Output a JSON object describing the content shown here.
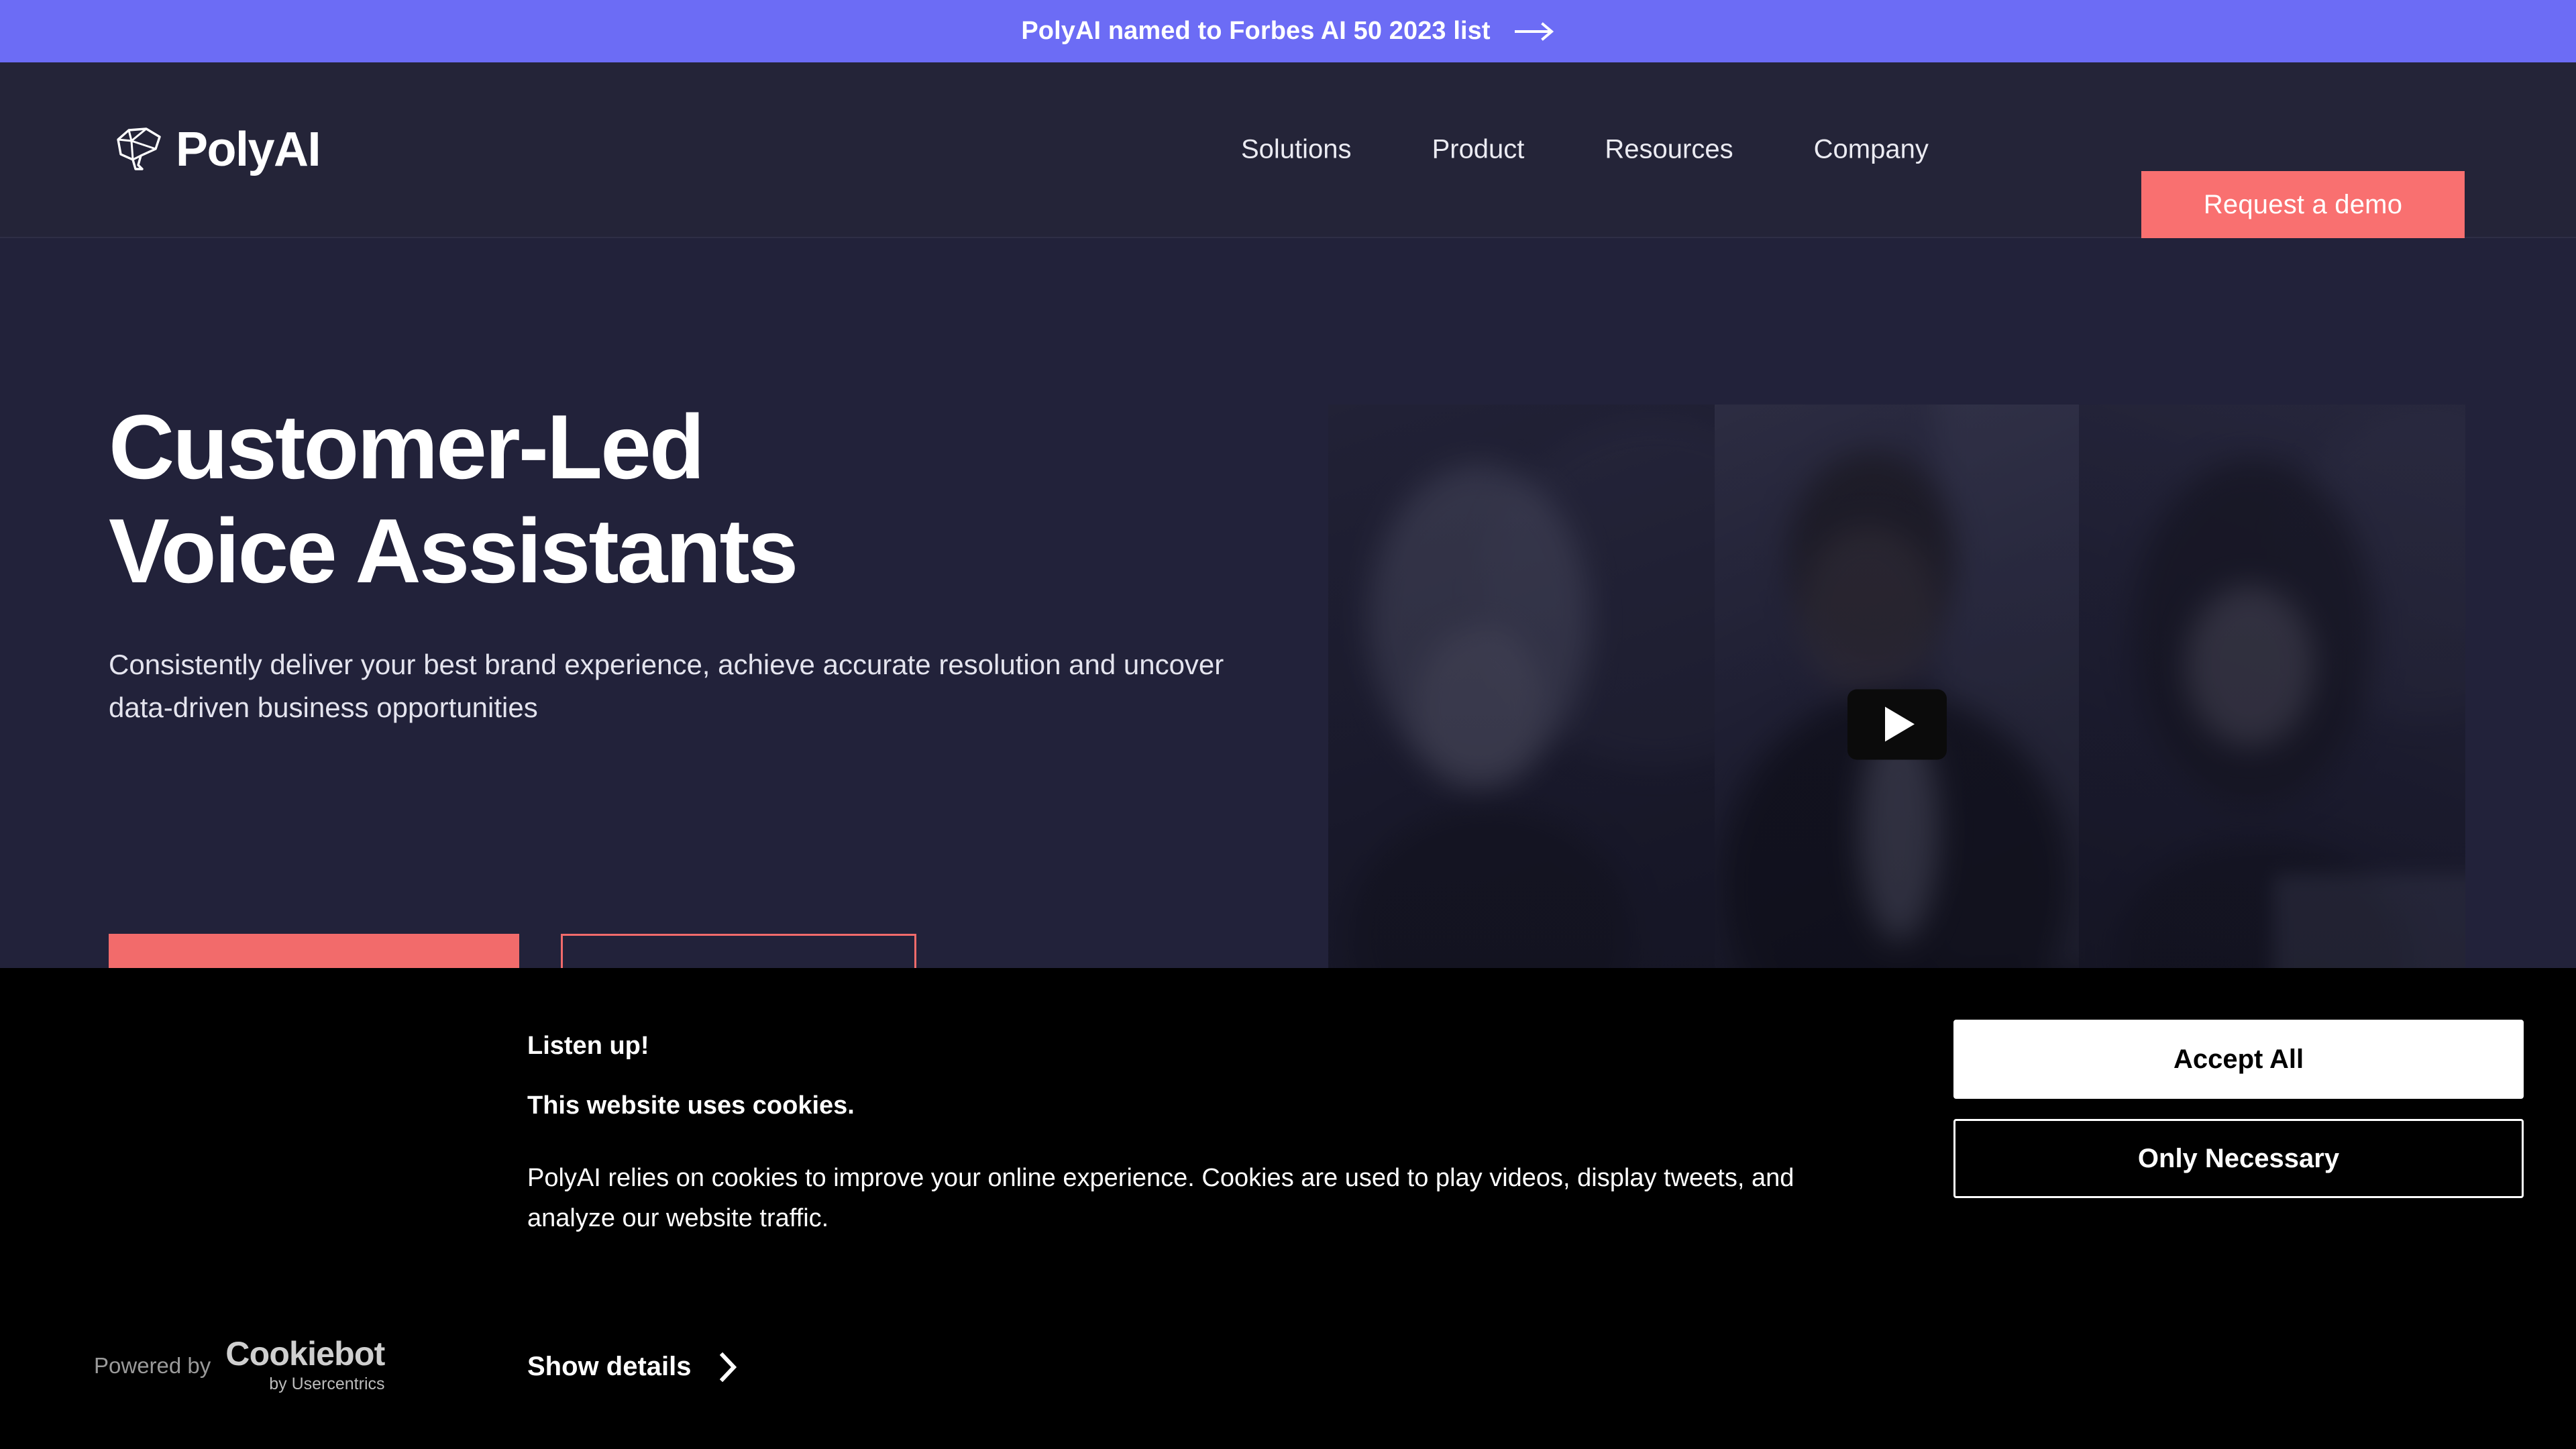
{
  "announcement": {
    "text": "PolyAI named to Forbes AI 50 2023 list",
    "arrow_icon": "arrow-right-icon",
    "background": "#6c6cf5"
  },
  "header": {
    "brand": {
      "name": "PolyAI",
      "logo_icon": "polyai-polygon-brain-icon"
    },
    "nav": [
      {
        "label": "Solutions"
      },
      {
        "label": "Product"
      },
      {
        "label": "Resources"
      },
      {
        "label": "Company"
      }
    ],
    "cta": {
      "label": "Request a demo",
      "background": "#f97070"
    },
    "background": "#242438"
  },
  "hero": {
    "title_line1": "Customer-Led",
    "title_line2": "Voice Assistants",
    "subtitle": "Consistently deliver your best brand experience, achieve accurate resolution and uncover data-driven business opportunities",
    "cta_primary": "",
    "cta_secondary": "",
    "accent_color": "#f26b6b",
    "background": "#22223a",
    "video": {
      "play_icon": "play-button-icon",
      "alt": "Three people smiling while talking on phones"
    }
  },
  "cookie_banner": {
    "heading": "Listen up!",
    "subheading": "This website uses cookies.",
    "body": "PolyAI relies on cookies to improve your online experience. Cookies are used to play videos, display tweets, and analyze our website traffic.",
    "show_details_label": "Show details",
    "show_details_icon": "chevron-right-icon",
    "powered_by_label": "Powered by",
    "provider_name": "Cookiebot",
    "provider_sub": "by Usercentrics",
    "buttons": {
      "accept_all": "Accept All",
      "only_necessary": "Only Necessary"
    },
    "background": "#000000"
  }
}
